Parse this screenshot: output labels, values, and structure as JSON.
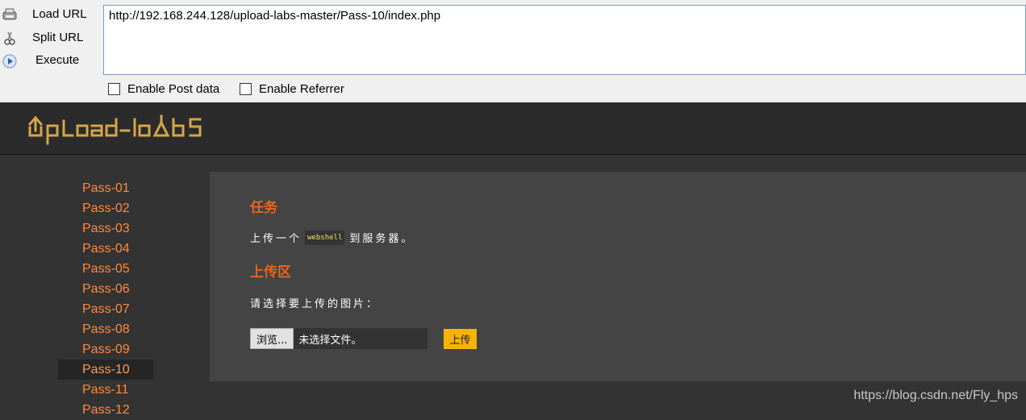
{
  "hackbar": {
    "load_url": "Load URL",
    "split_url": "Split URL",
    "execute": "Execute",
    "url": "http://192.168.244.128/upload-labs-master/Pass-10/index.php",
    "enable_post": "Enable Post data",
    "enable_referrer": "Enable Referrer"
  },
  "site": {
    "logo_text": "upload-labs",
    "accent": "#e8641b",
    "link_color": "#ff8a3d"
  },
  "sidebar": {
    "items": [
      "Pass-01",
      "Pass-02",
      "Pass-03",
      "Pass-04",
      "Pass-05",
      "Pass-06",
      "Pass-07",
      "Pass-08",
      "Pass-09",
      "Pass-10",
      "Pass-11",
      "Pass-12"
    ],
    "active": "Pass-10"
  },
  "main": {
    "task_title": "任务",
    "task_prefix": "上传一个",
    "task_code": "webshell",
    "task_suffix": "到服务器。",
    "upload_title": "上传区",
    "choose_label": "请选择要上传的图片：",
    "browse": "浏览...",
    "no_file": "未选择文件。",
    "upload_button": "上传"
  },
  "watermark": "https://blog.csdn.net/Fly_hps"
}
